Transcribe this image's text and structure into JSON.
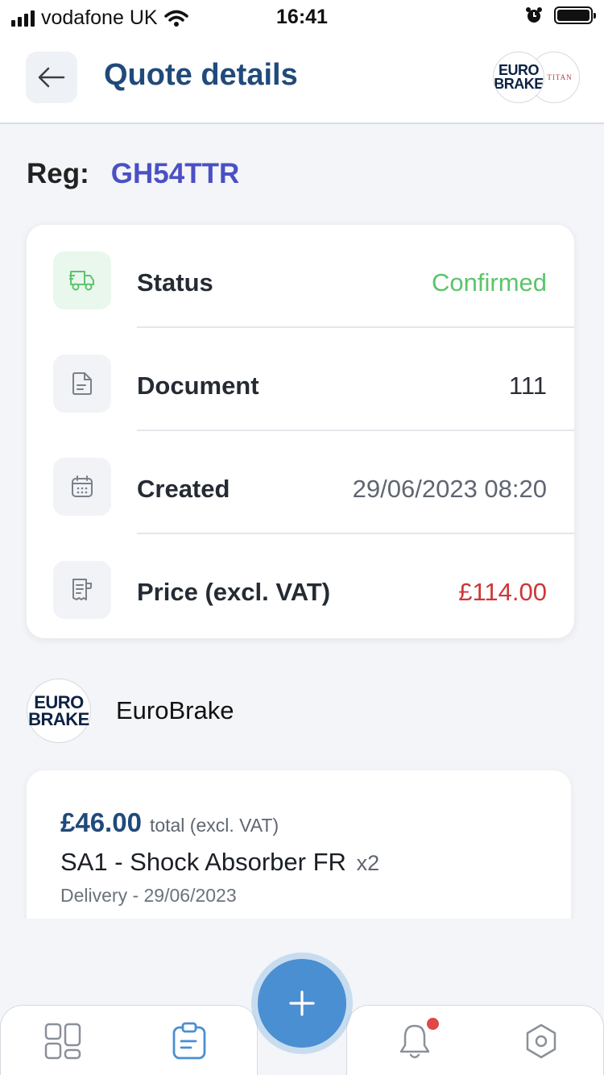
{
  "status_bar": {
    "carrier": "vodafone UK",
    "time": "16:41"
  },
  "header": {
    "title": "Quote details",
    "logo_primary_line1": "EURO",
    "logo_primary_line2": "BRAKE",
    "logo_secondary": "TITAN"
  },
  "vehicle": {
    "reg_label": "Reg:",
    "reg_value": "GH54TTR"
  },
  "details": [
    {
      "label": "Status",
      "value": "Confirmed",
      "icon": "truck-icon",
      "value_color": "#5cc46b"
    },
    {
      "label": "Document",
      "value": "111",
      "icon": "document-icon",
      "value_color": "#2b2f36"
    },
    {
      "label": "Created",
      "value": "29/06/2023 08:20",
      "icon": "calendar-icon",
      "value_color": "#5f6670"
    },
    {
      "label": "Price (excl. VAT)",
      "value": "£114.00",
      "icon": "receipt-icon",
      "value_color": "#cf3636"
    }
  ],
  "supplier": {
    "name": "EuroBrake",
    "logo_line1": "EURO",
    "logo_line2": "BRAKE"
  },
  "line_items": [
    {
      "price": "£46.00",
      "price_suffix": "total (excl. VAT)",
      "description": "SA1 - Shock Absorber FR",
      "quantity": "x2",
      "delivery": "Delivery - 29/06/2023"
    }
  ],
  "tab_bar": {
    "items": [
      "dashboard-icon",
      "quotes-icon",
      "add-icon",
      "notifications-icon",
      "settings-icon"
    ],
    "active": "quotes-icon",
    "notification_badge": true
  },
  "colors": {
    "accent": "#204a7a",
    "reg": "#4a50c4",
    "fab": "#4a8fd1",
    "badge": "#e04848"
  }
}
